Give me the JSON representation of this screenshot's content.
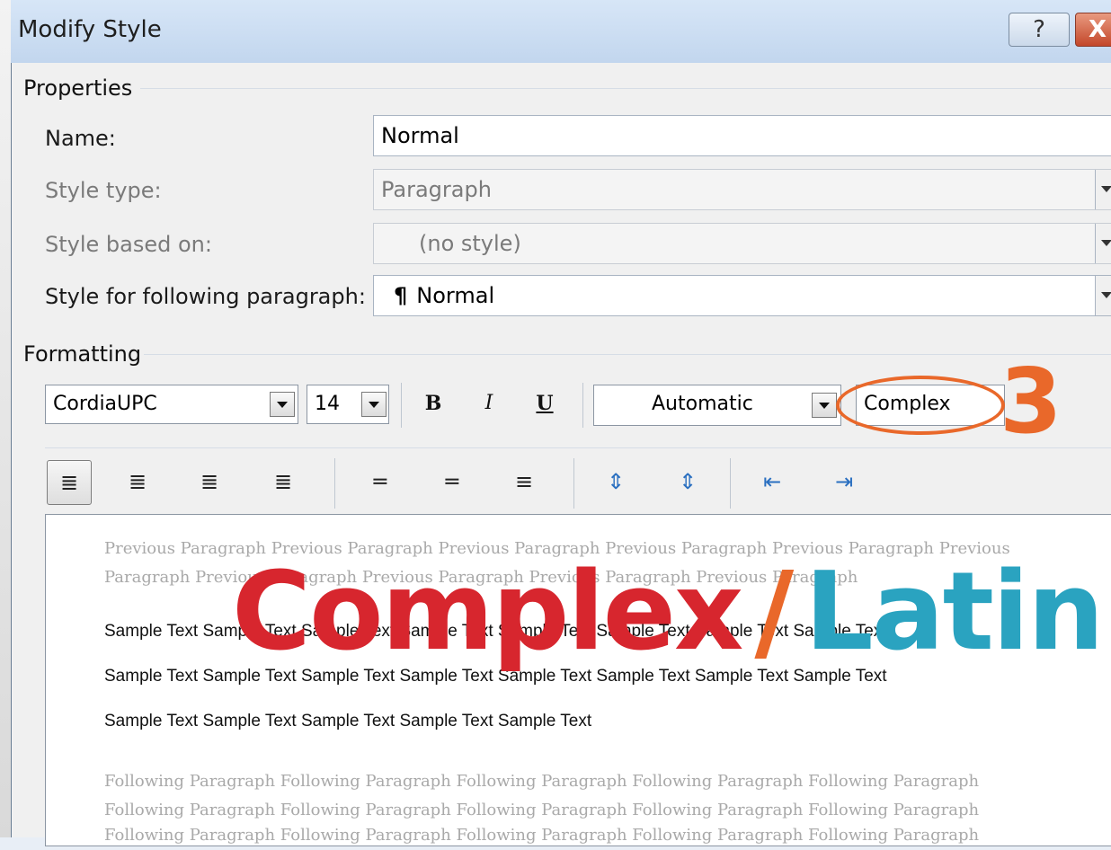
{
  "window": {
    "title": "Modify Style",
    "help_icon": "?",
    "close_icon": "X"
  },
  "properties": {
    "heading": "Properties",
    "name_label": "Name:",
    "name_value": "Normal",
    "style_type_label": "Style type:",
    "style_type_value": "Paragraph",
    "based_on_label": "Style based on:",
    "based_on_value": "(no style)",
    "following_label": "Style for following paragraph:",
    "following_icon": "¶",
    "following_value": "Normal"
  },
  "formatting": {
    "heading": "Formatting",
    "font": "CordiaUPC",
    "size": "14",
    "bold": "B",
    "italic": "I",
    "underline": "U",
    "color": "Automatic",
    "script": "Complex"
  },
  "toolbar_icons": [
    "align-left-icon",
    "align-center-icon",
    "align-right-icon",
    "justify-icon",
    "spacing-single-icon",
    "spacing-1-5-icon",
    "spacing-double-icon",
    "space-before-icon",
    "space-after-icon",
    "decrease-indent-icon",
    "increase-indent-icon"
  ],
  "preview": {
    "previous_line1": "Previous Paragraph Previous Paragraph Previous Paragraph Previous Paragraph Previous Paragraph Previous",
    "previous_line2": "Paragraph Previous Paragraph Previous Paragraph Previous Paragraph Previous Paragraph",
    "sample_line1": "Sample Text Sample Text Sample Text Sample Text Sample Text Sample Text Sample Text Sample Text",
    "sample_line2": "Sample Text Sample Text Sample Text Sample Text Sample Text Sample Text Sample Text Sample Text",
    "sample_line3": "Sample Text Sample Text Sample Text Sample Text Sample Text",
    "following_line1": "Following Paragraph Following Paragraph Following Paragraph Following Paragraph Following Paragraph",
    "following_line2": "Following Paragraph Following Paragraph Following Paragraph Following Paragraph Following Paragraph",
    "following_line3": "Following Paragraph Following Paragraph Following Paragraph Following Paragraph Following Paragraph"
  },
  "annotation": {
    "step_number": "3",
    "overlay_complex": "Complex",
    "overlay_slash": "/",
    "overlay_latin": "Latin",
    "colors": {
      "orange": "#e9682a",
      "red": "#d7262e",
      "teal": "#2aa3c0"
    }
  }
}
